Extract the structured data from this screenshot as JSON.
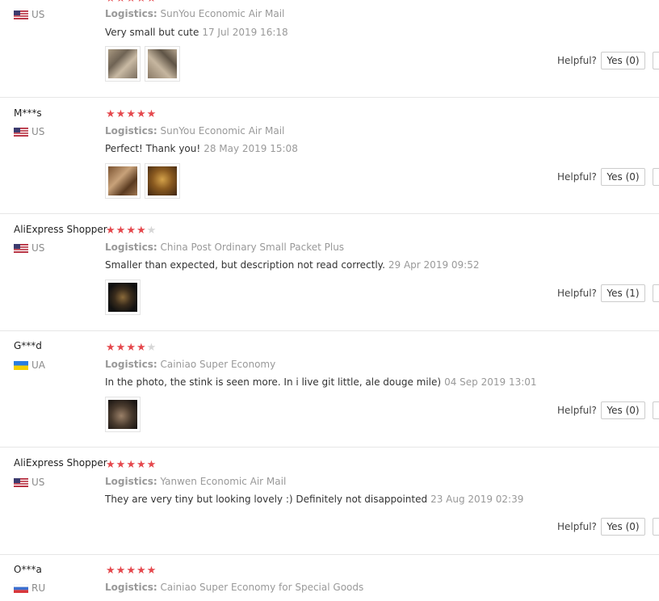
{
  "reviews": [
    {
      "user": "",
      "country": "US",
      "rating": 5,
      "logistics_label": "Logistics:",
      "logistics": "SunYou Economic Air Mail",
      "text": "Very small but cute",
      "date": "17 Jul 2019 16:18",
      "thumbs": [
        "photo-1",
        "photo-2"
      ],
      "helpful": "Helpful?",
      "yes": "Yes (0)"
    },
    {
      "user": "M***s",
      "country": "US",
      "rating": 5,
      "logistics_label": "Logistics:",
      "logistics": "SunYou Economic Air Mail",
      "text": "Perfect! Thank you!",
      "date": "28 May 2019 15:08",
      "thumbs": [
        "photo-1",
        "photo-2"
      ],
      "helpful": "Helpful?",
      "yes": "Yes (0)"
    },
    {
      "user": "AliExpress Shopper",
      "country": "US",
      "rating": 4,
      "logistics_label": "Logistics:",
      "logistics": "China Post Ordinary Small Packet Plus",
      "text": "Smaller than expected, but description not read correctly.",
      "date": "29 Apr 2019 09:52",
      "thumbs": [
        "photo-1"
      ],
      "helpful": "Helpful?",
      "yes": "Yes (1)"
    },
    {
      "user": "G***d",
      "country": "UA",
      "rating": 4,
      "logistics_label": "Logistics:",
      "logistics": "Cainiao Super Economy",
      "text": "In the photo, the stink is seen more. In i live git little, ale douge mile)",
      "date": "04 Sep 2019 13:01",
      "thumbs": [
        "photo-1"
      ],
      "helpful": "Helpful?",
      "yes": "Yes (0)"
    },
    {
      "user": "AliExpress Shopper",
      "country": "US",
      "rating": 5,
      "logistics_label": "Logistics:",
      "logistics": "Yanwen Economic Air Mail",
      "text": "They are very tiny but looking lovely :) Definitely not disappointed",
      "date": "23 Aug 2019 02:39",
      "thumbs": [],
      "helpful": "Helpful?",
      "yes": "Yes (0)"
    },
    {
      "user": "O***a",
      "country": "RU",
      "rating": 5,
      "logistics_label": "Logistics:",
      "logistics": "Cainiao Super Economy for Special Goods",
      "text": "",
      "date": "",
      "thumbs": [],
      "helpful": "",
      "yes": ""
    }
  ],
  "colors": {
    "star_on": "#e5484d",
    "star_off": "#d6d6d6",
    "meta": "#999999"
  }
}
